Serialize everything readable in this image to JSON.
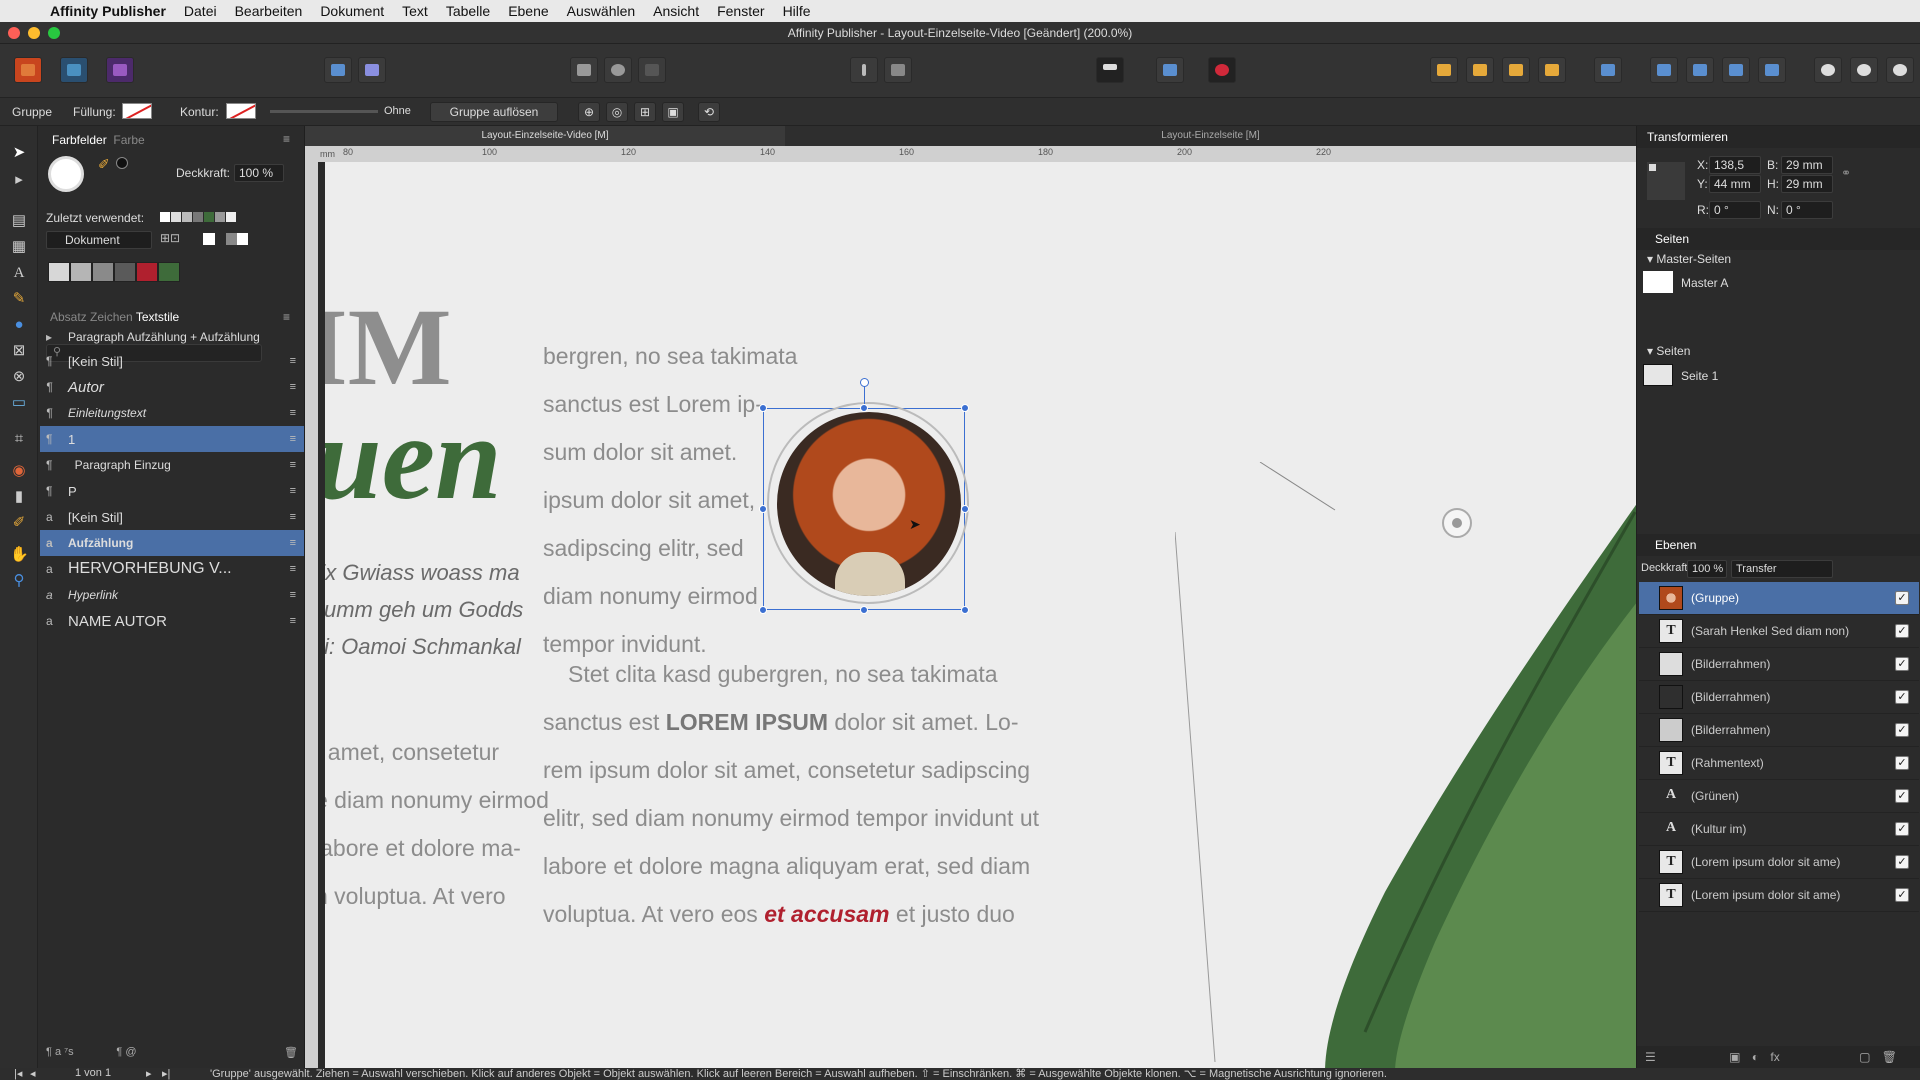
{
  "menubar": {
    "app": "Affinity Publisher",
    "items": [
      "Datei",
      "Bearbeiten",
      "Dokument",
      "Text",
      "Tabelle",
      "Ebene",
      "Auswählen",
      "Ansicht",
      "Fenster",
      "Hilfe"
    ]
  },
  "window": {
    "title": "Affinity Publisher - Layout-Einzelseite-Video [Geändert] (200.0%)"
  },
  "context": {
    "type": "Gruppe",
    "fill_label": "Füllung:",
    "stroke_label": "Kontur:",
    "stroke_value": "Ohne",
    "ungroup_label": "Gruppe auflösen"
  },
  "left": {
    "swatches_tab": "Farbfelder",
    "color_tab": "Farbe",
    "opacity_label": "Deckkraft:",
    "opacity_value": "100 %",
    "recent_label": "Zuletzt verwendet:",
    "palette": "Dokument",
    "style_tabs": [
      "Absatz",
      "Zeichen",
      "Textstile"
    ],
    "group_header": "Paragraph Aufzählung + Aufzählung",
    "styles": [
      {
        "icon": "¶",
        "label": "[Kein Stil]"
      },
      {
        "icon": "¶",
        "label": "Autor"
      },
      {
        "icon": "¶",
        "label": "Einleitungstext"
      },
      {
        "icon": "¶",
        "label": "1"
      },
      {
        "icon": "¶",
        "label": "Paragraph Einzug"
      },
      {
        "icon": "¶",
        "label": "P"
      },
      {
        "icon": "a",
        "label": "[Kein Stil]"
      },
      {
        "icon": "a",
        "label": "Aufzählung"
      },
      {
        "icon": "a",
        "label": "HERVORHEBUNG V..."
      },
      {
        "icon": "a",
        "label": "Hyperlink"
      },
      {
        "icon": "a",
        "label": "NAME AUTOR"
      }
    ]
  },
  "canvas": {
    "tab1": "Layout-Einzelseite-Video [M]",
    "tab2": "Layout-Einzelseite [M]",
    "ruler_marks": [
      "mm",
      "80",
      "100",
      "120",
      "140",
      "160",
      "180",
      "200",
      "220"
    ],
    "headline_fragment": "IM",
    "script_fragment": "uen",
    "col1_lines": [
      "bergren, no sea takimata",
      "sanctus est Lorem ip-",
      "sum dolor sit amet.",
      "ipsum dolor sit amet,",
      "sadipscing elitr, sed",
      "diam nonumy eirmod",
      "tempor invidunt."
    ],
    "italic_lines": [
      "rix Gwiass woass ma",
      "kumm geh um Godds",
      "zi: Oamoi Schmankal"
    ],
    "col2_line1": "Stet clita kasd gubergren, no sea takimata",
    "col2_line2_pre": "sanctus est ",
    "col2_line2_bold": "LOREM IPSUM",
    "col2_line2_post": " dolor sit amet. Lo-",
    "col2_lines": [
      "rem ipsum dolor sit amet, consetetur sadipscing",
      "elitr, sed diam nonumy eirmod tempor invidunt ut",
      "labore et dolore magna aliquyam erat, sed diam"
    ],
    "col2_last_pre": "voluptua. At vero eos ",
    "col2_last_red": "et accusam",
    "col2_last_post": " et justo duo",
    "left_lines": [
      "t amet, consetetur",
      "e diam nonumy eirmod",
      "labore et dolore ma-",
      "n voluptua. At vero"
    ]
  },
  "transform": {
    "title": "Transformieren",
    "x_label": "X:",
    "x": "138,5 mm",
    "y_label": "Y:",
    "y": "44 mm",
    "b_label": "B:",
    "b": "29 mm",
    "h_label": "H:",
    "h": "29 mm",
    "r_label": "R:",
    "r": "0 °",
    "n_label": "N:",
    "n": "0 °"
  },
  "pages": {
    "title": "Seiten",
    "master_header": "Master-Seiten",
    "master": "Master A",
    "pages_header": "Seiten",
    "page": "Seite 1"
  },
  "layers": {
    "title": "Ebenen",
    "opacity_label": "Deckkraft:",
    "opacity": "100 %",
    "blend": "Transfer",
    "items": [
      {
        "name": "(Gruppe)",
        "thumb": "photo",
        "selected": true
      },
      {
        "name": "(Sarah Henkel Sed diam non)",
        "thumb": "T"
      },
      {
        "name": "(Bilderrahmen)",
        "thumb": "frame-light"
      },
      {
        "name": "(Bilderrahmen)",
        "thumb": "frame-dark"
      },
      {
        "name": "(Bilderrahmen)",
        "thumb": "photo"
      },
      {
        "name": "(Rahmentext)",
        "thumb": "T"
      },
      {
        "name": "(Grünen)",
        "thumb": "A"
      },
      {
        "name": "(Kultur im)",
        "thumb": "A"
      },
      {
        "name": "(Lorem ipsum dolor sit ame)",
        "thumb": "T"
      },
      {
        "name": "(Lorem ipsum dolor sit ame)",
        "thumb": "T"
      }
    ]
  },
  "status": {
    "page": "1 von 1",
    "hint": "'Gruppe' ausgewählt. Ziehen = Auswahl verschieben. Klick auf anderes Objekt = Objekt auswählen. Klick auf leeren Bereich = Auswahl aufheben. ⇧ = Einschränken. ⌘ = Ausgewählte Objekte klonen. ⌥ = Magnetische Ausrichtung ignorieren."
  },
  "colors": {
    "selection": "#4a6fa6",
    "handles": "#3b6fd1",
    "accent_red": "#b0202e",
    "leaf_green": "#3e6b3a"
  }
}
